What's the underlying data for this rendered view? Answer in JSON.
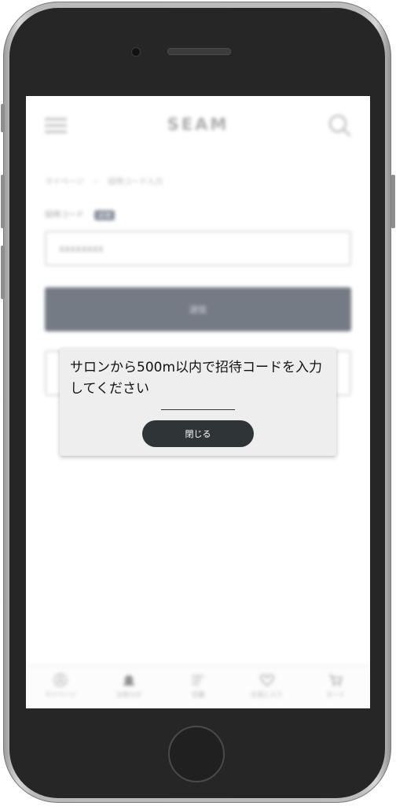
{
  "header": {
    "logo": "SEAM",
    "menu_icon": "hamburger-menu-icon",
    "search_icon": "search-icon"
  },
  "breadcrumb": {
    "items": [
      "マイページ",
      "招待コード入力"
    ],
    "separator": "›"
  },
  "form": {
    "code_label": "招待コード",
    "required_badge": "必須",
    "code_value": "xxxxxxxx",
    "submit_label": "送信"
  },
  "dialog": {
    "message": "サロンから500m以内で招待コードを入力してください",
    "close_label": "閉じる"
  },
  "tabbar": {
    "items": [
      {
        "label": "マイページ",
        "icon": "user-icon"
      },
      {
        "label": "お知らせ",
        "icon": "bell-icon"
      },
      {
        "label": "店舗",
        "icon": "shop-icon"
      },
      {
        "label": "お気に入り",
        "icon": "heart-icon"
      },
      {
        "label": "カート",
        "icon": "cart-icon"
      }
    ]
  },
  "colors": {
    "primary": "#2c3544",
    "dialog_button": "#2f3437",
    "dialog_bg": "#eeeeee"
  }
}
